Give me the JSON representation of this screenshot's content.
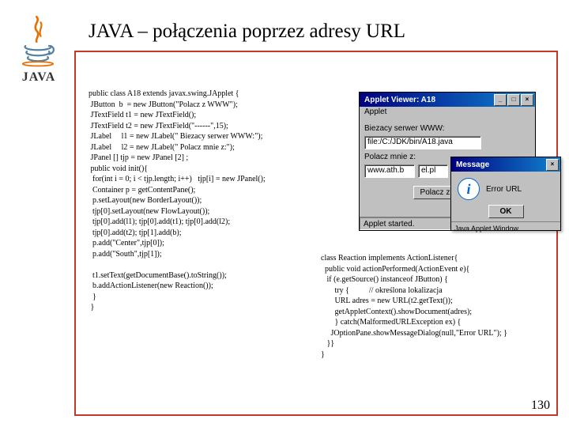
{
  "title": "JAVA – połączenia poprzez adresy URL",
  "logo_text": "JAVA",
  "page_number": "130",
  "code_left": "public class A18 extends javax.swing.JApplet {\n JButton  b  = new JButton(\"Polacz z WWW\");\n JTextField t1 = new JTextField();\n JTextField t2 = new JTextField(\"------\",15);\n JLabel     l1 = new JLabel(\" Biezacy serwer WWW:\");\n JLabel     l2 = new JLabel(\" Polacz mnie z:\");\n JPanel [] tjp = new JPanel [2] ;\n public void init(){\n  for(int i = 0; i < tjp.length; i++)   tjp[i] = new JPanel();\n  Container p = getContentPane();\n  p.setLayout(new BorderLayout());\n  tjp[0].setLayout(new FlowLayout());\n  tjp[0].add(l1); tjp[0].add(t1); tjp[0].add(l2);\n  tjp[0].add(t2); tjp[1].add(b);\n  p.add(\"Center\",tjp[0]);\n  p.add(\"South\",tjp[1]);\n\n  t1.setText(getDocumentBase().toString());\n  b.addActionListener(new Reaction());\n  }\n }",
  "code_right": "class Reaction implements ActionListener{\n  public void actionPerformed(ActionEvent e){\n   if (e.getSource() instanceof JButton) {\n       try {          // określona lokalizacja\n       URL adres = new URL(t2.getText());\n       getAppletContext().showDocument(adres);\n       } catch(MalformedURLException ex) {\n     JOptionPane.showMessageDialog(null,\"Error URL\"); }\n   }}\n}",
  "applet": {
    "title": "Applet Viewer: A18",
    "menu": "Applet",
    "label_server": "Biezacy serwer WWW:",
    "field_server": "file:/C:/JDK/bin/A18.java",
    "label_connect": "Polacz mnie z:",
    "field_host": "www.ath.b",
    "field_domain": "el.pl",
    "button": "Polacz z WWW",
    "status": "Applet started."
  },
  "message": {
    "title": "Message",
    "text": "Error URL",
    "ok": "OK",
    "status": "Java Applet Window"
  },
  "win_controls": {
    "min": "_",
    "max": "□",
    "close": "×"
  }
}
